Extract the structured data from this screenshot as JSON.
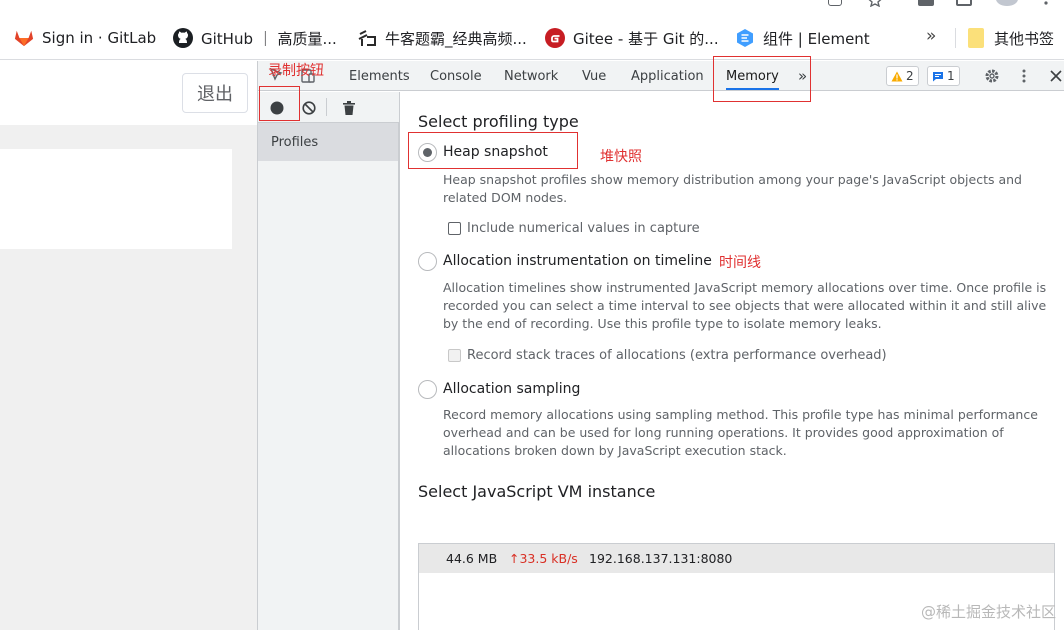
{
  "bookmarks": [
    {
      "label": "Sign in · GitLab",
      "icon": "gitlab-icon"
    },
    {
      "label": "GitHub ｜ 高质量...",
      "icon": "github-icon"
    },
    {
      "label": "牛客题霸_经典高频...",
      "icon": "nowcoder-icon"
    },
    {
      "label": "Gitee - 基于 Git 的...",
      "icon": "gitee-icon"
    },
    {
      "label": "组件 | Element",
      "icon": "element-icon"
    }
  ],
  "bookmarks_more": "»",
  "bookmarks_folder": "其他书签",
  "page": {
    "logout_label": "退出"
  },
  "devtools": {
    "tabs": [
      "Elements",
      "Console",
      "Network",
      "Vue",
      "Application",
      "Memory"
    ],
    "active_tab": "Memory",
    "more_tabs": "»",
    "warnings_count": "2",
    "issues_count": "1",
    "sidebar_item": "Profiles"
  },
  "memory": {
    "select_type_heading": "Select profiling type",
    "heap_label": "Heap snapshot",
    "heap_desc": "Heap snapshot profiles show memory distribution among your page's JavaScript objects and related DOM nodes.",
    "heap_option": "Include numerical values in capture",
    "timeline_label": "Allocation instrumentation on timeline",
    "timeline_desc": "Allocation timelines show instrumented JavaScript memory allocations over time. Once profile is recorded you can select a time interval to see objects that were allocated within it and still alive by the end of recording. Use this profile type to isolate memory leaks.",
    "timeline_option": "Record stack traces of allocations (extra performance overhead)",
    "sampling_label": "Allocation sampling",
    "sampling_desc": "Record memory allocations using sampling method. This profile type has minimal performance overhead and can be used for long running operations. It provides good approximation of allocations broken down by JavaScript execution stack.",
    "vm_heading": "Select JavaScript VM instance",
    "vm_memory": "44.6 MB",
    "vm_rate": "↑33.5 kB/s",
    "vm_host": "192.168.137.131:8080"
  },
  "annotations": {
    "record_button": "录制按钮",
    "heap_snapshot": "堆快照",
    "timeline": "时间线"
  },
  "watermark": "@稀土掘金技术社区",
  "colors": {
    "accent": "#1a73e8",
    "annotation": "#e03131",
    "rate": "#d93025"
  }
}
